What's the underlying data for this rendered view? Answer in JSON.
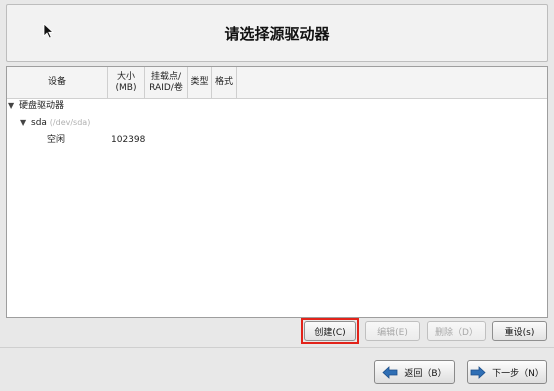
{
  "header": {
    "title": "请选择源驱动器"
  },
  "table": {
    "columns": [
      "设备",
      "大小\n(MB)",
      "挂载点/\nRAID/卷",
      "类型",
      "格式"
    ],
    "rows": [
      {
        "label": "硬盘驱动器"
      },
      {
        "label": "sda",
        "sublabel": "(/dev/sda)"
      },
      {
        "label": "空闲",
        "size": "102398"
      }
    ]
  },
  "actions": {
    "create": "创建(C)",
    "edit": "编辑(E)",
    "delete": "删除（D）",
    "reset": "重设(s)"
  },
  "nav": {
    "back": "返回（B）",
    "next": "下一步（N）"
  },
  "icons": {
    "cursor": "mouse-pointer-icon",
    "expand": "triangle-down-icon",
    "back": "arrow-left-icon",
    "next": "arrow-right-icon"
  },
  "colors": {
    "highlight": "#e2231a",
    "arrow": "#2f6fb5"
  }
}
